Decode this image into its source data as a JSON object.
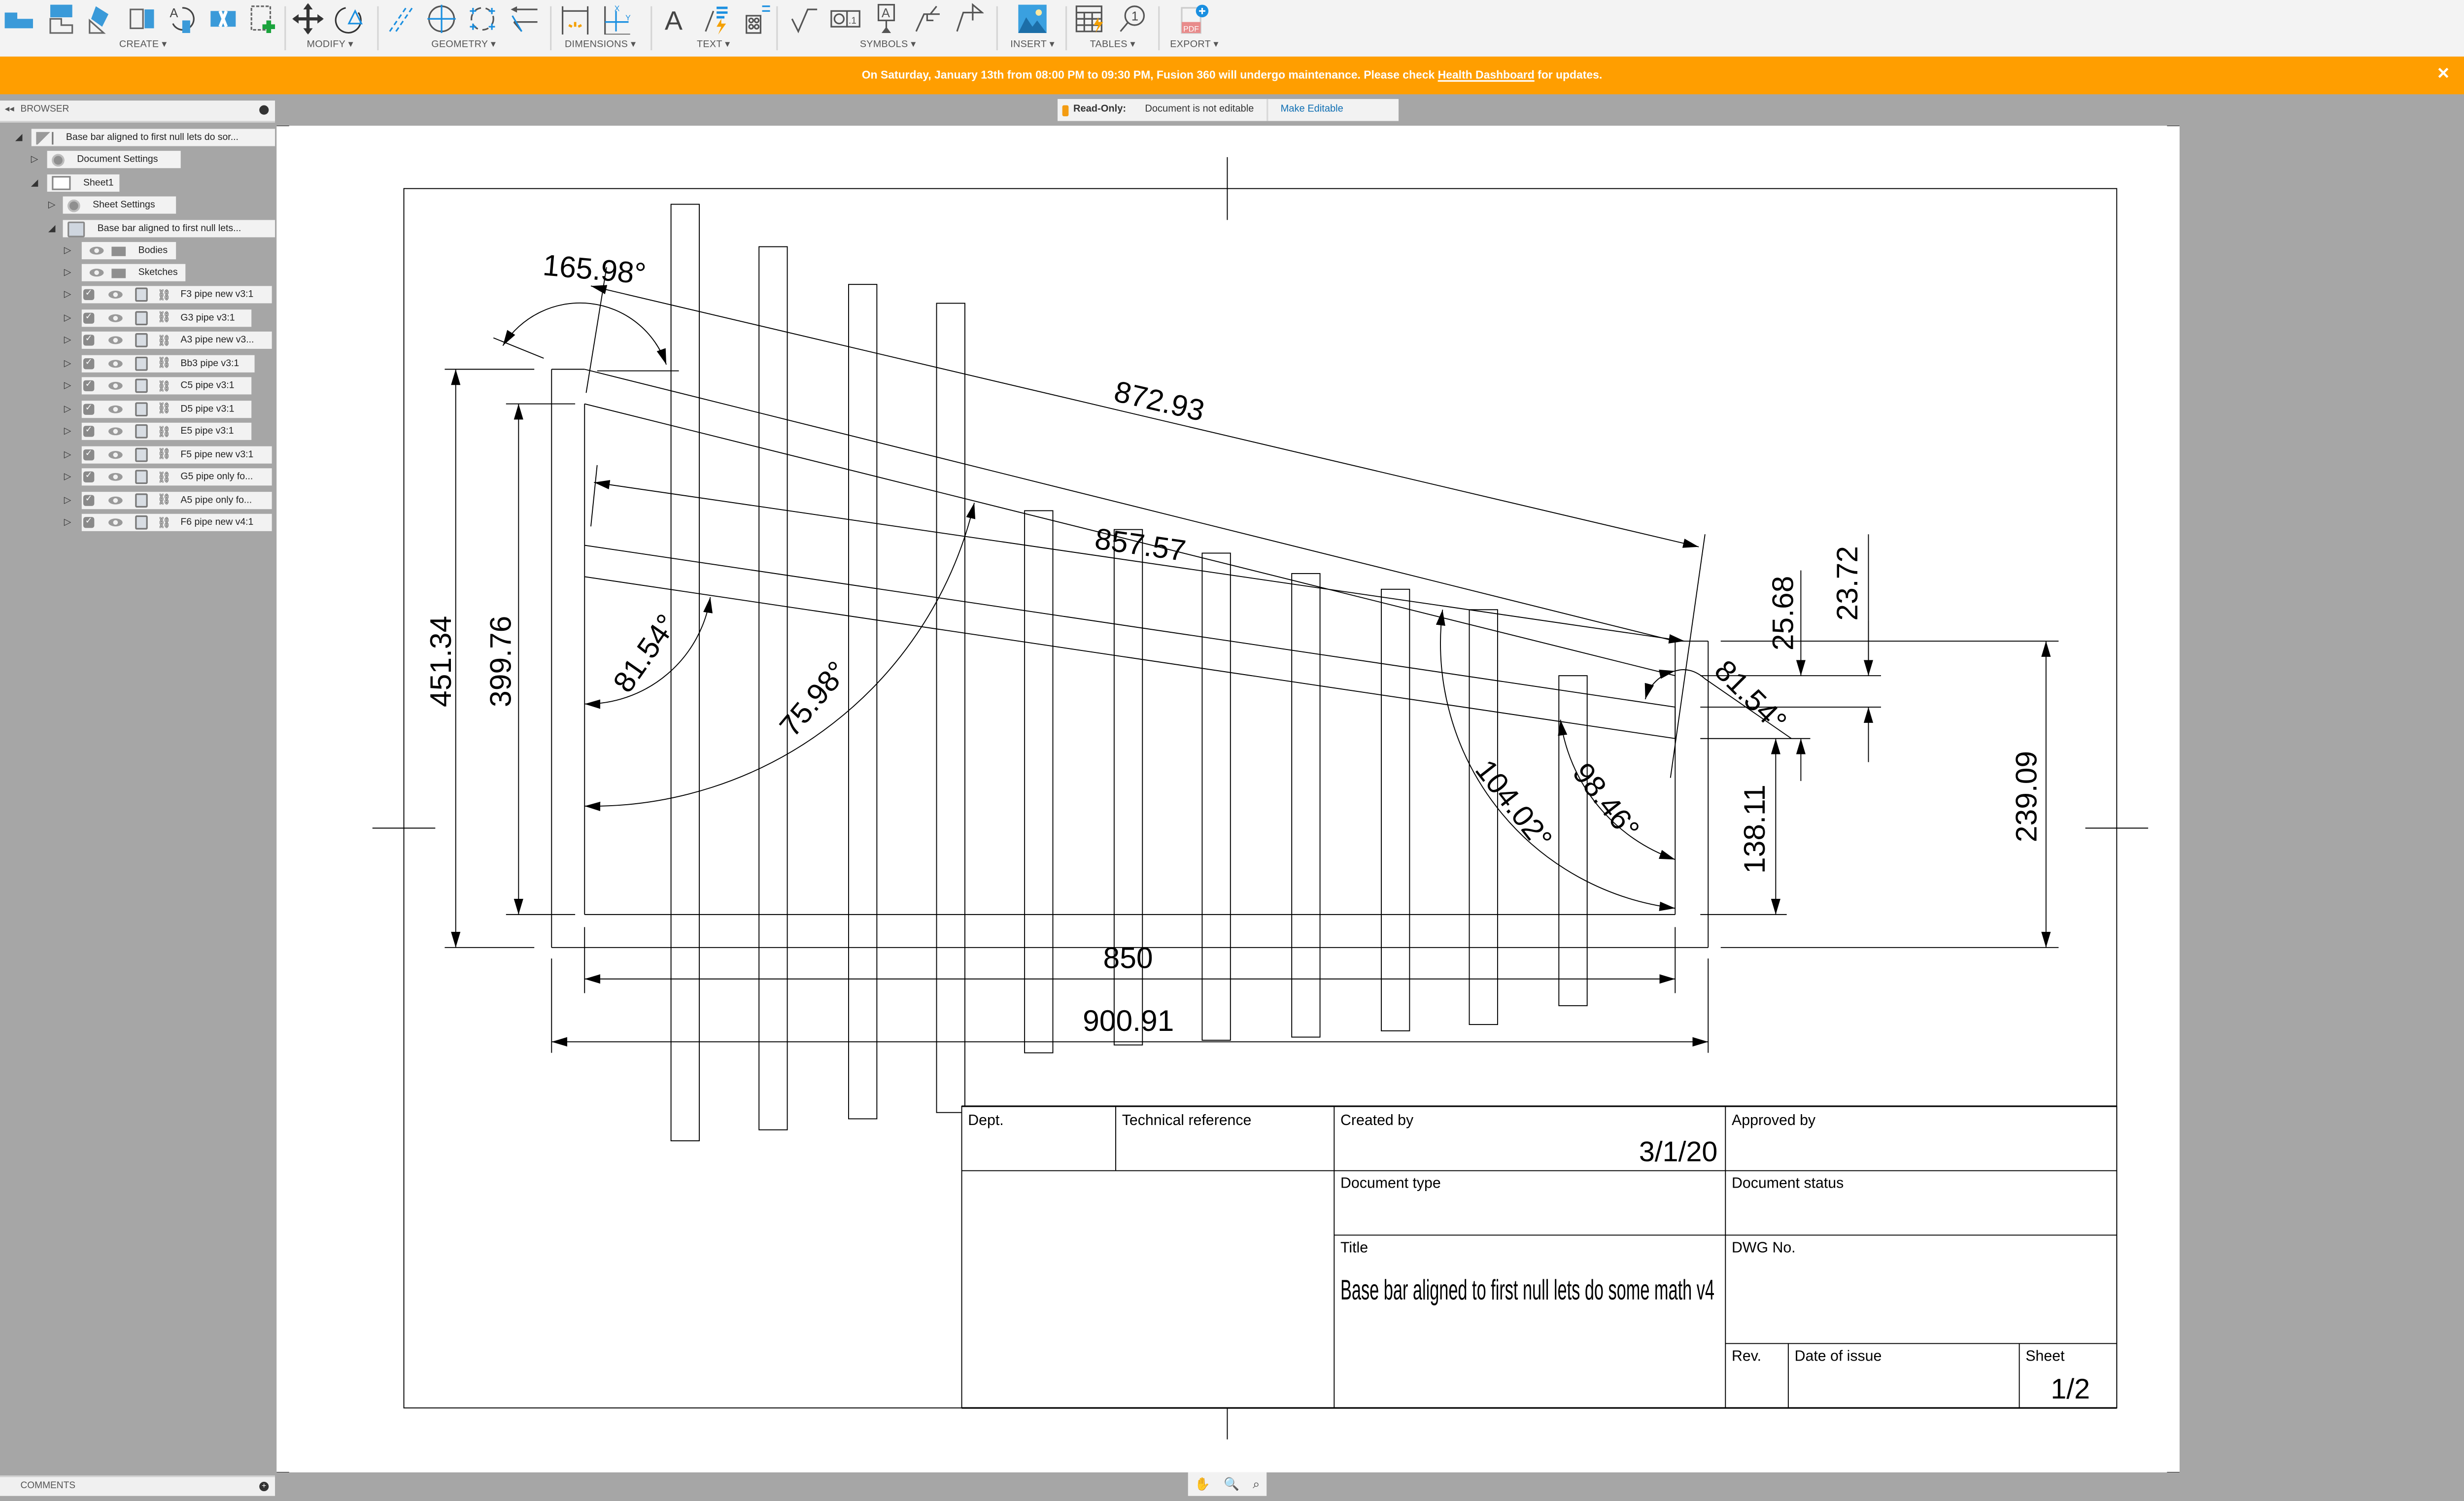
{
  "toolbar": {
    "groups": [
      {
        "label": "CREATE",
        "icons": [
          "base-view-icon",
          "projected-view-icon",
          "section-view-icon",
          "detail-view-icon",
          "rotate-view-icon",
          "break-view-icon",
          "sketch-add-icon"
        ]
      },
      {
        "label": "MODIFY",
        "icons": [
          "move-icon",
          "rotate-icon"
        ]
      },
      {
        "label": "GEOMETRY",
        "icons": [
          "centerline-icon",
          "center-mark-icon",
          "center-mark-pattern-icon",
          "edge-extension-icon"
        ]
      },
      {
        "label": "DIMENSIONS",
        "icons": [
          "dimension-icon",
          "ordinate-dimension-icon"
        ]
      },
      {
        "label": "TEXT",
        "icons": [
          "text-icon",
          "leader-text-icon",
          "balloon-note-icon"
        ]
      },
      {
        "label": "SYMBOLS",
        "icons": [
          "surface-texture-icon",
          "feature-control-frame-icon",
          "datum-identifier-icon",
          "welding-symbol-icon",
          "edge-symbol-icon"
        ]
      },
      {
        "label": "INSERT",
        "icons": [
          "insert-image-icon"
        ]
      },
      {
        "label": "TABLES",
        "icons": [
          "table-icon",
          "balloon-icon"
        ]
      },
      {
        "label": "EXPORT",
        "icons": [
          "export-pdf-icon"
        ]
      }
    ]
  },
  "banner": {
    "text_before": "On Saturday, January 13th from 08:00 PM to 09:30 PM, Fusion 360 will undergo maintenance. Please check ",
    "link": "Health Dashboard",
    "text_after": " for updates.",
    "close": "✕",
    "color": "#ff9e00"
  },
  "readonly": {
    "label": "Read-Only:",
    "message": "Document is not editable",
    "action": "Make Editable"
  },
  "browser": {
    "title": "BROWSER",
    "root": "Base bar aligned to first null lets do sor...",
    "document_settings": "Document Settings",
    "sheet": "Sheet1",
    "sheet_settings": "Sheet Settings",
    "view": "Base bar aligned to first null lets...",
    "folders": [
      "Bodies",
      "Sketches"
    ],
    "components": [
      "F3 pipe new v3:1",
      "G3 pipe v3:1",
      "A3 pipe new v3...",
      "Bb3 pipe v3:1",
      "C5 pipe v3:1",
      "D5 pipe v3:1",
      "E5 pipe v3:1",
      "F5 pipe new v3:1",
      "G5 pipe only fo...",
      "A5 pipe only fo...",
      "F6 pipe new v4:1"
    ]
  },
  "comments": {
    "title": "COMMENTS"
  },
  "drawing": {
    "dimensions": {
      "angle_top": "165.98°",
      "len_top": "872.93",
      "len_mid": "857.57",
      "angle_left": "81.54°",
      "angle_mid": "75.98°",
      "angle_right_small": "81.54°",
      "angle_104": "104.02°",
      "angle_98": "98.46°",
      "height_451": "451.34",
      "height_399": "399.76",
      "d_25": "25.68",
      "d_23": "23.72",
      "d_138": "138.11",
      "d_239": "239.09",
      "width_850": "850",
      "width_900": "900.91"
    },
    "title_block": {
      "dept": "Dept.",
      "tech_ref": "Technical reference",
      "created_by": "Created by",
      "created_date": "3/1/20",
      "approved_by": "Approved by",
      "doc_type": "Document type",
      "doc_status": "Document status",
      "title_label": "Title",
      "title_value": "Base bar aligned to first null lets do some math v4",
      "dwg_no": "DWG No.",
      "rev": "Rev.",
      "date_of_issue": "Date of issue",
      "sheet_label": "Sheet",
      "sheet_value": "1/2"
    }
  },
  "navbar": {
    "icons": [
      "pan-icon",
      "zoom-window-icon",
      "zoom-fit-icon"
    ]
  }
}
